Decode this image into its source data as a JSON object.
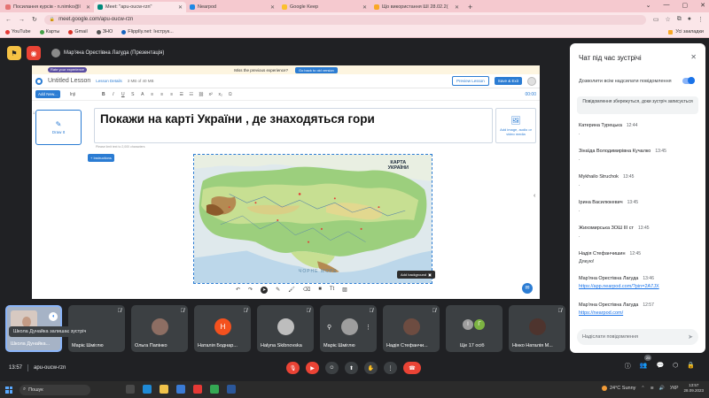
{
  "browser": {
    "tabs": [
      {
        "label": "Посилання курсів - n.nimko@l",
        "color": "#e57373",
        "active": false
      },
      {
        "label": "Meet: \"apu-oucw-rzn\"",
        "color": "#00897b",
        "active": true
      },
      {
        "label": "Nearpod",
        "color": "#1e88e5",
        "active": false
      },
      {
        "label": "Google Keep",
        "color": "#fbc02d",
        "active": false
      },
      {
        "label": "Що використання ШІ 28.02.2(",
        "color": "#f9a825",
        "active": false
      }
    ],
    "url": "meet.google.com/apu-oucw-rzn",
    "bookmarks": [
      "YouTube",
      "Карты",
      "Gmail",
      "ЗНО",
      "Flipplly.net: Інструк..."
    ],
    "bookmarks_right": "Усі закладки"
  },
  "meet": {
    "presenter_label": "Мар'яна Орестівна Лагуда (Презентація)",
    "meeting_code": "apu-oucw-rzn",
    "time": "13:57",
    "participants_count": "25"
  },
  "lesson": {
    "promo_pill": "Rate your experience",
    "promo_text": "Miss the previous experience?",
    "promo_button": "Go back to old version",
    "title": "Untitled Lesson",
    "lesson_details": "Lesson Details",
    "storage": "3 MB of 40 MB",
    "preview_button": "Preview Lesson",
    "save_button": "Save & Exit",
    "add_new": "Add New...",
    "font": "Inji",
    "timer": "00:00",
    "slide_number": "1",
    "slide_label": "Draw It",
    "question": "Покажи на карті України , де знаходяться гори",
    "media_hint": "Add image, audio or video media",
    "char_hint": "Please limit text to 2,000 characters",
    "instructions_label": "Instructions",
    "map_title_line1": "КАРТА",
    "map_title_line2": "УКРАЇНИ",
    "sea_label": "ЧОРНЕ МОРЕ",
    "add_background": "Add background"
  },
  "tiles": [
    {
      "name": "Школа Дунайка...",
      "type": "self"
    },
    {
      "name": "Маріє Шміглю",
      "type": "blank"
    },
    {
      "name": "Ольга Папінко",
      "type": "avatar",
      "color": "#8d6e63"
    },
    {
      "name": "Наталія Боднар...",
      "type": "letter",
      "letter": "Н",
      "color": "#f4511e"
    },
    {
      "name": "Halyna Skibnovska",
      "type": "avatar",
      "color": "#bdbdbd"
    },
    {
      "name": "Маріє Шміглю",
      "type": "controls"
    },
    {
      "name": "Надія Стефанчи...",
      "type": "avatar",
      "color": "#6d4c41"
    },
    {
      "name": "Ще 17 осіб",
      "type": "group"
    },
    {
      "name": "Нінко Наталія М...",
      "type": "avatar",
      "color": "#4e342e"
    }
  ],
  "toast": "Школа Дунайка залишає зустріч",
  "chat": {
    "title": "Чат під час зустрічі",
    "allow_label": "Дозволити всім надсилати повідомлення",
    "notice": "Повідомлення збережуться, доки зустріч записується",
    "messages": [
      {
        "who": "Катерина Турецька",
        "time": "12:44",
        "text": "."
      },
      {
        "who": "Зінаїда Володимирівна Кучалко",
        "time": "13:45",
        "text": "."
      },
      {
        "who": "Mykhailo Struchok",
        "time": "13:45",
        "text": "."
      },
      {
        "who": "Ірина Василюкевич",
        "time": "13:45",
        "text": "."
      },
      {
        "who": "Жихомирська ЗОШ ІІІ ст",
        "time": "13:45",
        "text": "."
      },
      {
        "who": "Надія Стефанчишин",
        "time": "12:45",
        "text": "Дякую!"
      },
      {
        "who": "Мар'яна Орестівна Лагуда",
        "time": "13:46",
        "link": "https://app.nearpod.com/?pin=2A7JX"
      },
      {
        "who": "Мар'яна Орестівна Лагуда",
        "time": "12:57",
        "link": "https://nearpod.com/"
      }
    ],
    "input_placeholder": "Надіслати повідомлення"
  },
  "taskbar": {
    "search": "Пошук",
    "weather": "24°C  Sunny",
    "lang": "УКР",
    "time": "13:57",
    "date": "28.09.2023"
  }
}
